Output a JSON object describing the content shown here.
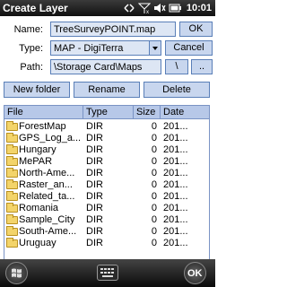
{
  "window": {
    "title": "Create Layer",
    "time": "10:01"
  },
  "form": {
    "name_label": "Name:",
    "name_value": "TreeSurveyPOINT.map",
    "ok_label": "OK",
    "type_label": "Type:",
    "type_value": "MAP - DigiTerra",
    "cancel_label": "Cancel",
    "path_label": "Path:",
    "path_value": "\\Storage Card\\Maps",
    "backslash_label": "\\",
    "up_label": ".."
  },
  "actions": {
    "new_folder": "New folder",
    "rename": "Rename",
    "delete": "Delete"
  },
  "list": {
    "headers": [
      "File",
      "Type",
      "Size",
      "Date"
    ],
    "rows": [
      {
        "name": "ForestMap",
        "type": "DIR",
        "size": "0",
        "date": "201..."
      },
      {
        "name": "GPS_Log_a...",
        "type": "DIR",
        "size": "0",
        "date": "201..."
      },
      {
        "name": "Hungary",
        "type": "DIR",
        "size": "0",
        "date": "201..."
      },
      {
        "name": "MePAR",
        "type": "DIR",
        "size": "0",
        "date": "201..."
      },
      {
        "name": "North-Ame...",
        "type": "DIR",
        "size": "0",
        "date": "201..."
      },
      {
        "name": "Raster_an...",
        "type": "DIR",
        "size": "0",
        "date": "201..."
      },
      {
        "name": "Related_ta...",
        "type": "DIR",
        "size": "0",
        "date": "201..."
      },
      {
        "name": "Romania",
        "type": "DIR",
        "size": "0",
        "date": "201..."
      },
      {
        "name": "Sample_City",
        "type": "DIR",
        "size": "0",
        "date": "201..."
      },
      {
        "name": "South-Ame...",
        "type": "DIR",
        "size": "0",
        "date": "201..."
      },
      {
        "name": "Uruguay",
        "type": "DIR",
        "size": "0",
        "date": "201..."
      }
    ]
  },
  "softkeys": {
    "ok": "OK",
    "left_icon": "windows-start-icon",
    "center_icon": "keyboard-icon"
  },
  "colors": {
    "field_bg": "#dde6f4",
    "button_bg": "#c8d6ee",
    "border": "#5a7fb8",
    "titlebar": "#111111"
  }
}
